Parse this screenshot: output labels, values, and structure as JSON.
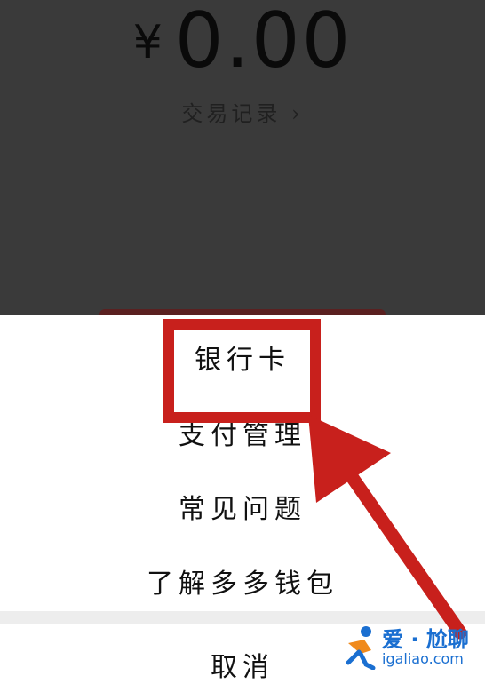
{
  "wallet": {
    "currency_symbol": "¥",
    "balance": "0.00",
    "records_link": "交易记录 ›"
  },
  "menu": {
    "items": [
      "银行卡",
      "支付管理",
      "常见问题",
      "了解多多钱包"
    ],
    "cancel": "取消"
  },
  "watermark": {
    "title": "爱 · 尬聊",
    "url": "igaliao.com"
  },
  "colors": {
    "overlay": "#3a3a3a",
    "highlight": "#c8201c",
    "watermark": "#1a6fd1"
  }
}
